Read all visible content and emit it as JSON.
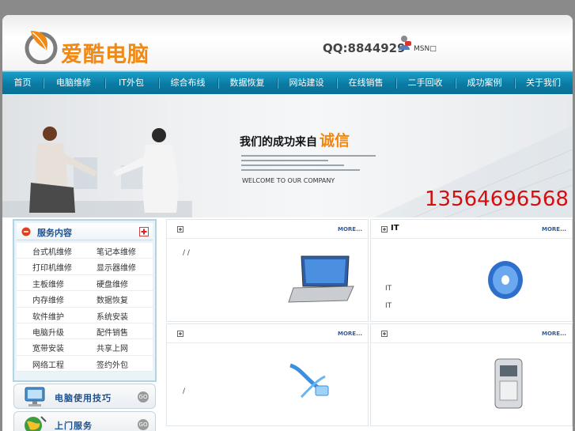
{
  "header": {
    "logo_text": "爱酷电脑",
    "qq": "QQ:8844929",
    "msn": "MSN□"
  },
  "nav": {
    "items": [
      "首页",
      "电脑维修",
      "IT外包",
      "综合布线",
      "数据恢复",
      "网站建设",
      "在线销售",
      "二手回收",
      "成功案例",
      "关于我们"
    ]
  },
  "banner": {
    "title": "我们的成功来自",
    "title_em": "诚信",
    "welcome": "WELCOME TO OUR COMPANY",
    "phone": "13564696568"
  },
  "sidebar": {
    "services_title": "服务内容",
    "services": [
      [
        "台式机维修",
        "笔记本维修"
      ],
      [
        "打印机维修",
        "显示器维修"
      ],
      [
        "主板维修",
        "硬盘维修"
      ],
      [
        "内存维修",
        "数据恢复"
      ],
      [
        "软件维护",
        "系统安装"
      ],
      [
        "电脑升级",
        "配件销售"
      ],
      [
        "宽带安装",
        "共享上网"
      ],
      [
        "网络工程",
        "签约外包"
      ]
    ],
    "tips_label": "电脑使用技巧",
    "onsite_label": "上门服务",
    "go": "GO"
  },
  "panels": [
    {
      "title": "",
      "more": "MORE...",
      "text": [
        "/ /"
      ]
    },
    {
      "title": "IT",
      "more": "MORE...",
      "text": [
        "IT",
        "IT"
      ]
    },
    {
      "title": "",
      "more": "MORE...",
      "text": [
        "/"
      ]
    },
    {
      "title": "",
      "more": "MORE...",
      "text": []
    }
  ],
  "colors": {
    "brand_orange": "#f08a14",
    "nav_blue": "#0a7ba3",
    "phone_red": "#d31010",
    "heading_blue": "#1d4f8c"
  }
}
